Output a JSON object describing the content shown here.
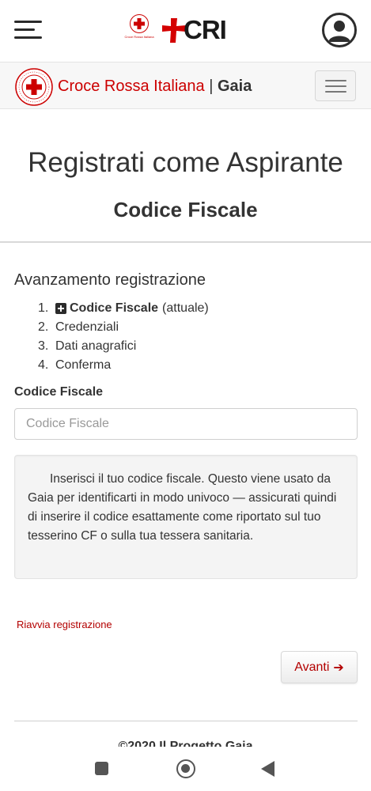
{
  "app_bar": {
    "brand_text": "CRI",
    "emblem_caption": "Croce Rossa Italiana"
  },
  "navbar": {
    "brand_name": "Croce Rossa Italiana",
    "separator": "|",
    "app_name": "Gaia"
  },
  "page": {
    "title": "Registrati come Aspirante",
    "subtitle": "Codice Fiscale"
  },
  "progress": {
    "title": "Avanzamento registrazione",
    "steps": [
      {
        "number": "1.",
        "label": "Codice Fiscale",
        "suffix": "(attuale)"
      },
      {
        "number": "2.",
        "label": "Credenziali"
      },
      {
        "number": "3.",
        "label": "Dati anagrafici"
      },
      {
        "number": "4.",
        "label": "Conferma"
      }
    ]
  },
  "form": {
    "field_label": "Codice Fiscale",
    "field_value": "",
    "field_placeholder": "Codice Fiscale",
    "help_text": "Inserisci il tuo codice fiscale. Questo viene usato da Gaia per identificarti in modo univoco — assicurati quindi di inserire il codice esattamente come riportato sul tuo tesserino CF o sulla tua tessera sanitaria.",
    "restart_link": "Riavvia registrazione",
    "next_button": "Avanti",
    "next_icon": "arrow-right-icon"
  },
  "footer": {
    "text": "©2020 Il Progetto Gaia"
  },
  "colors": {
    "brand_red": "#cc0000",
    "link_red": "#b30000",
    "text": "#333333"
  }
}
